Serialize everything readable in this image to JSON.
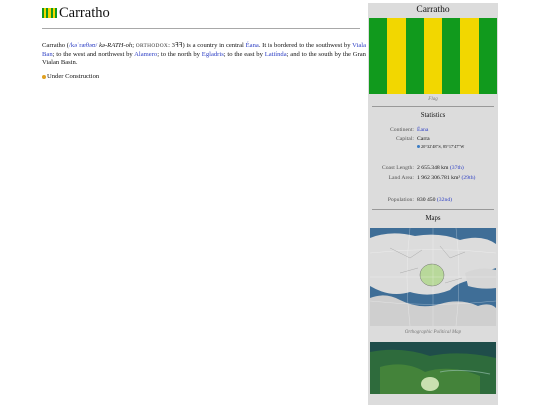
{
  "article": {
    "title": "Carratho",
    "intro": {
      "name": "Carratho",
      "ipa": "/kəˈræθəʊ/",
      "pronunciation": "kə-RATH-oh",
      "script_label": "ORTHODOX",
      "script_value": "3ꟻꟻ",
      "text1": "is a country in central",
      "continent_link": "Éana",
      "text2": ". It is bordered to the southwest by",
      "link_viala": "Viala Ban",
      "text3": "; to the west and northwest by",
      "link_alamero": "Alamero",
      "text4": "; to the north by",
      "link_egladris": "Egladris",
      "text5": "; to the east by",
      "link_latiinda": "Latiínda",
      "text6": "; and to the south by the Gran Vialan Basin."
    },
    "status": "Under Construction"
  },
  "infobox": {
    "title": "Carratho",
    "flag_caption": "Flag",
    "statistics_heading": "Statistics",
    "continent_label": "Continent",
    "continent_value": "Éana",
    "capital_label": "Capital",
    "capital_value": "Carra",
    "capital_coords": "20°32′48″S, 85°17′47″W",
    "coast_label": "Coast Length",
    "coast_value": "2 655.348 km",
    "coast_rank": "(37th)",
    "land_label": "Land Area",
    "land_value": "1 962 306.781 km²",
    "land_rank": "(29th)",
    "population_label": "Population",
    "population_value": "830 450",
    "population_rank": "(32nd)",
    "maps_heading": "Maps",
    "map_caption": "Orthographic Political Map"
  },
  "colors": {
    "flag_green": "#119a1d",
    "flag_yellow": "#f2d700",
    "link": "#2c3ec4",
    "infobox_bg": "#dcdcdc",
    "bullet": "#e0a020"
  }
}
